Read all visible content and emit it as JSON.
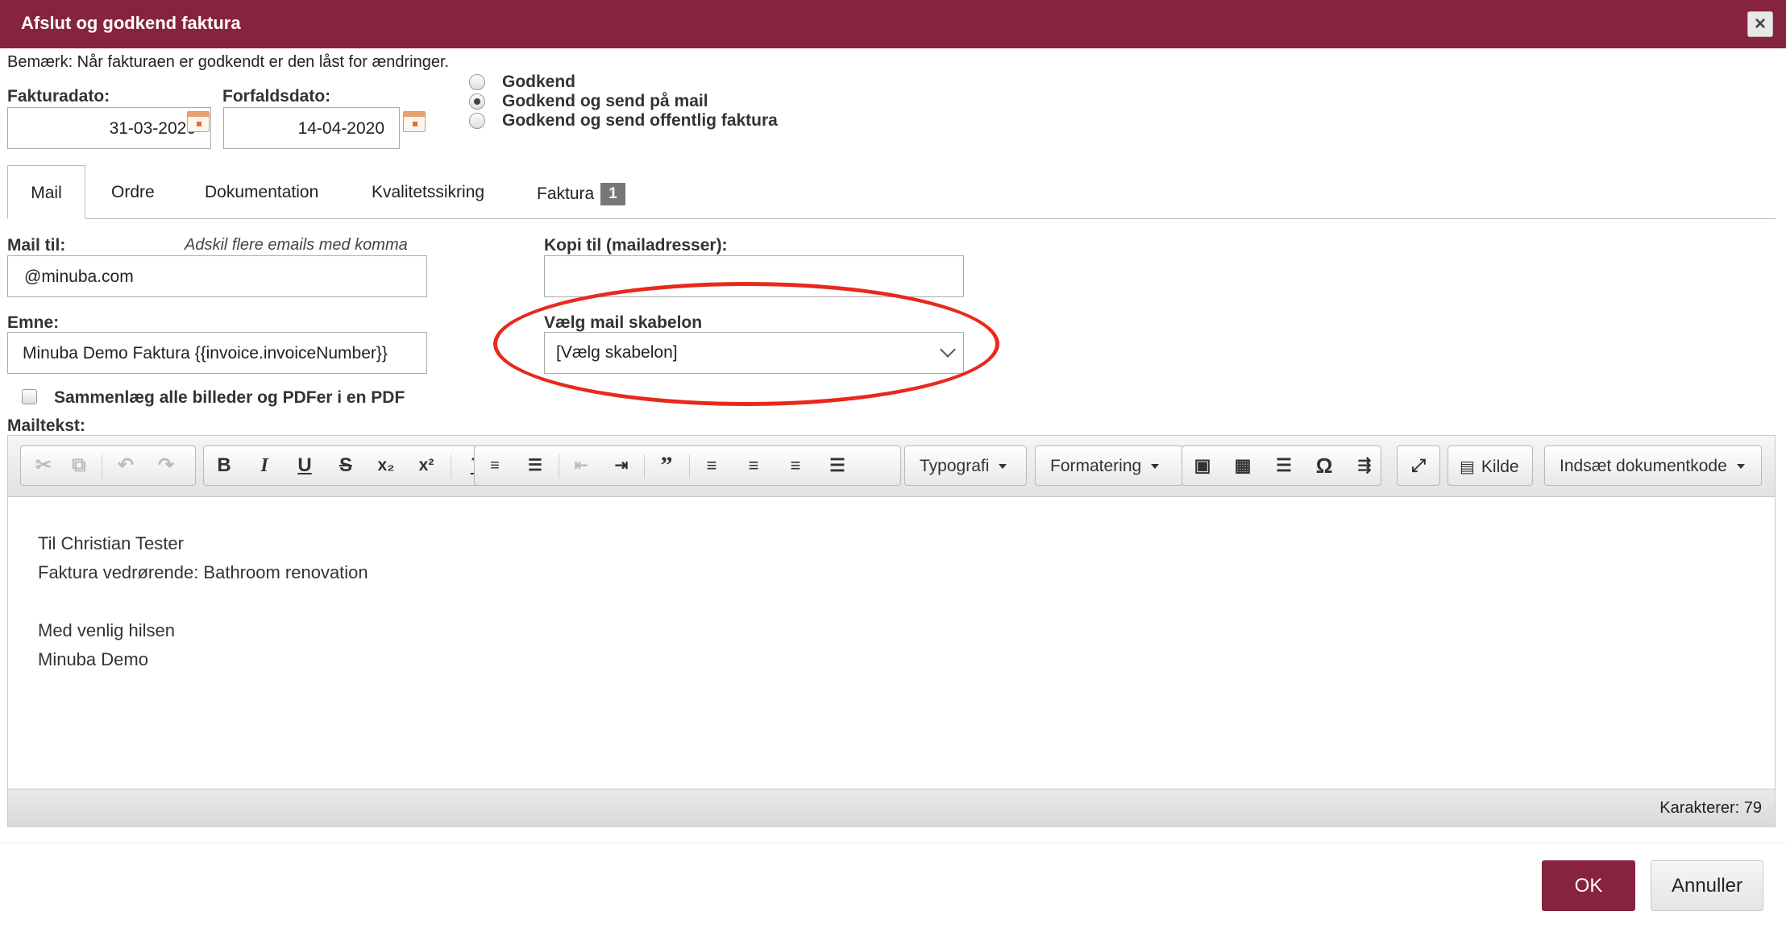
{
  "dialog": {
    "title": "Afslut og godkend faktura",
    "close_icon": "close-icon"
  },
  "note": "Bemærk: Når fakturaen er godkendt er den låst for ændringer.",
  "dates": {
    "invoice_label": "Fakturadato:",
    "invoice_value": "31-03-2020",
    "due_label": "Forfaldsdato:",
    "due_value": "14-04-2020"
  },
  "approve_options": [
    {
      "label": "Godkend",
      "checked": false
    },
    {
      "label": "Godkend og send på mail",
      "checked": true
    },
    {
      "label": "Godkend og send offentlig faktura",
      "checked": false
    }
  ],
  "tabs": [
    {
      "label": "Mail",
      "active": true
    },
    {
      "label": "Ordre"
    },
    {
      "label": "Dokumentation"
    },
    {
      "label": "Kvalitetssikring"
    },
    {
      "label": "Faktura",
      "badge": "1"
    }
  ],
  "mail": {
    "to_label": "Mail til:",
    "to_hint": "Adskil flere emails med komma",
    "to_value": "@minuba.com",
    "cc_label": "Kopi til (mailadresser):",
    "cc_value": "",
    "subject_label": "Emne:",
    "subject_value": "Minuba Demo Faktura {{invoice.invoiceNumber}}",
    "template_label": "Vælg mail skabelon",
    "template_value": "[Vælg skabelon]",
    "merge_label": "Sammenlæg alle billeder og PDFer i en PDF",
    "merge_checked": false,
    "body_label": "Mailtekst:"
  },
  "editor": {
    "toolbar": {
      "typography": "Typografi",
      "formatting": "Formatering",
      "source": "Kilde",
      "insert_code": "Indsæt dokumentkode"
    },
    "lines": [
      "Til Christian Tester",
      "Faktura vedrørende: Bathroom renovation",
      "",
      "Med venlig hilsen",
      "Minuba Demo"
    ],
    "char_count": "Karakterer: 79"
  },
  "buttons": {
    "ok": "OK",
    "cancel": "Annuller"
  },
  "colors": {
    "brand": "#86233f",
    "annotation": "#e8291c"
  }
}
